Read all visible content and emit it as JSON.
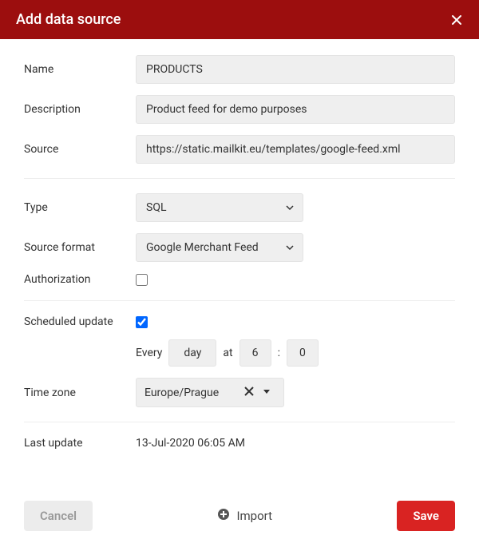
{
  "header": {
    "title": "Add data source"
  },
  "fields": {
    "name_label": "Name",
    "name_value": "PRODUCTS",
    "description_label": "Description",
    "description_value": "Product feed for demo purposes",
    "source_label": "Source",
    "source_value": "https://static.mailkit.eu/templates/google-feed.xml",
    "type_label": "Type",
    "type_value": "SQL",
    "source_format_label": "Source format",
    "source_format_value": "Google Merchant Feed",
    "authorization_label": "Authorization",
    "authorization_checked": false,
    "scheduled_update_label": "Scheduled update",
    "scheduled_update_checked": true,
    "every_label": "Every",
    "interval_value": "day",
    "at_label": "at",
    "hour_value": "6",
    "colon": ":",
    "minute_value": "0",
    "timezone_label": "Time zone",
    "timezone_value": "Europe/Prague",
    "last_update_label": "Last update",
    "last_update_value": "13-Jul-2020 06:05 AM"
  },
  "footer": {
    "cancel_label": "Cancel",
    "import_label": "Import",
    "save_label": "Save"
  }
}
